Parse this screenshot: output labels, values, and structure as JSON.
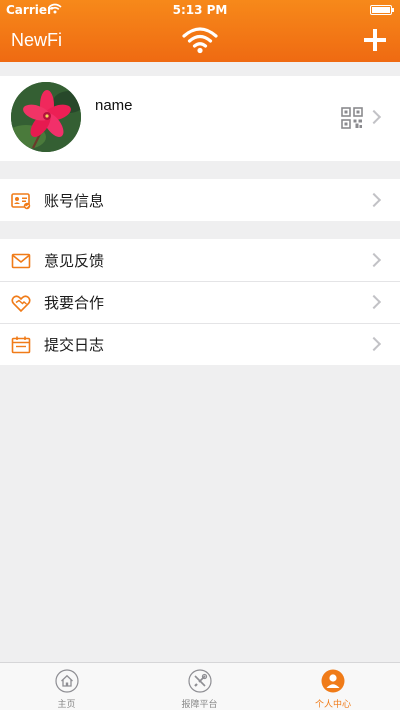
{
  "status_bar": {
    "carrier": "Carrier",
    "time": "5:13 PM"
  },
  "nav": {
    "title": "NewFi",
    "center_icon": "wifi-icon",
    "right_icon": "plus-icon"
  },
  "profile": {
    "name": "name",
    "qr_icon": "qr-code-icon"
  },
  "menu_group_1": [
    {
      "label": "账号信息",
      "icon": "id-card-icon"
    }
  ],
  "menu_group_2": [
    {
      "label": "意见反馈",
      "icon": "envelope-icon"
    },
    {
      "label": "我要合作",
      "icon": "handshake-heart-icon"
    },
    {
      "label": "提交日志",
      "icon": "calendar-icon"
    }
  ],
  "tabs": [
    {
      "label": "主页",
      "icon": "home-icon",
      "active": false
    },
    {
      "label": "报障平台",
      "icon": "tools-icon",
      "active": false
    },
    {
      "label": "个人中心",
      "icon": "person-icon",
      "active": true
    }
  ],
  "colors": {
    "accent": "#f07b18",
    "nav_gradient_top": "#f7891a",
    "nav_gradient_bottom": "#ef6a12",
    "background": "#efeff0"
  }
}
